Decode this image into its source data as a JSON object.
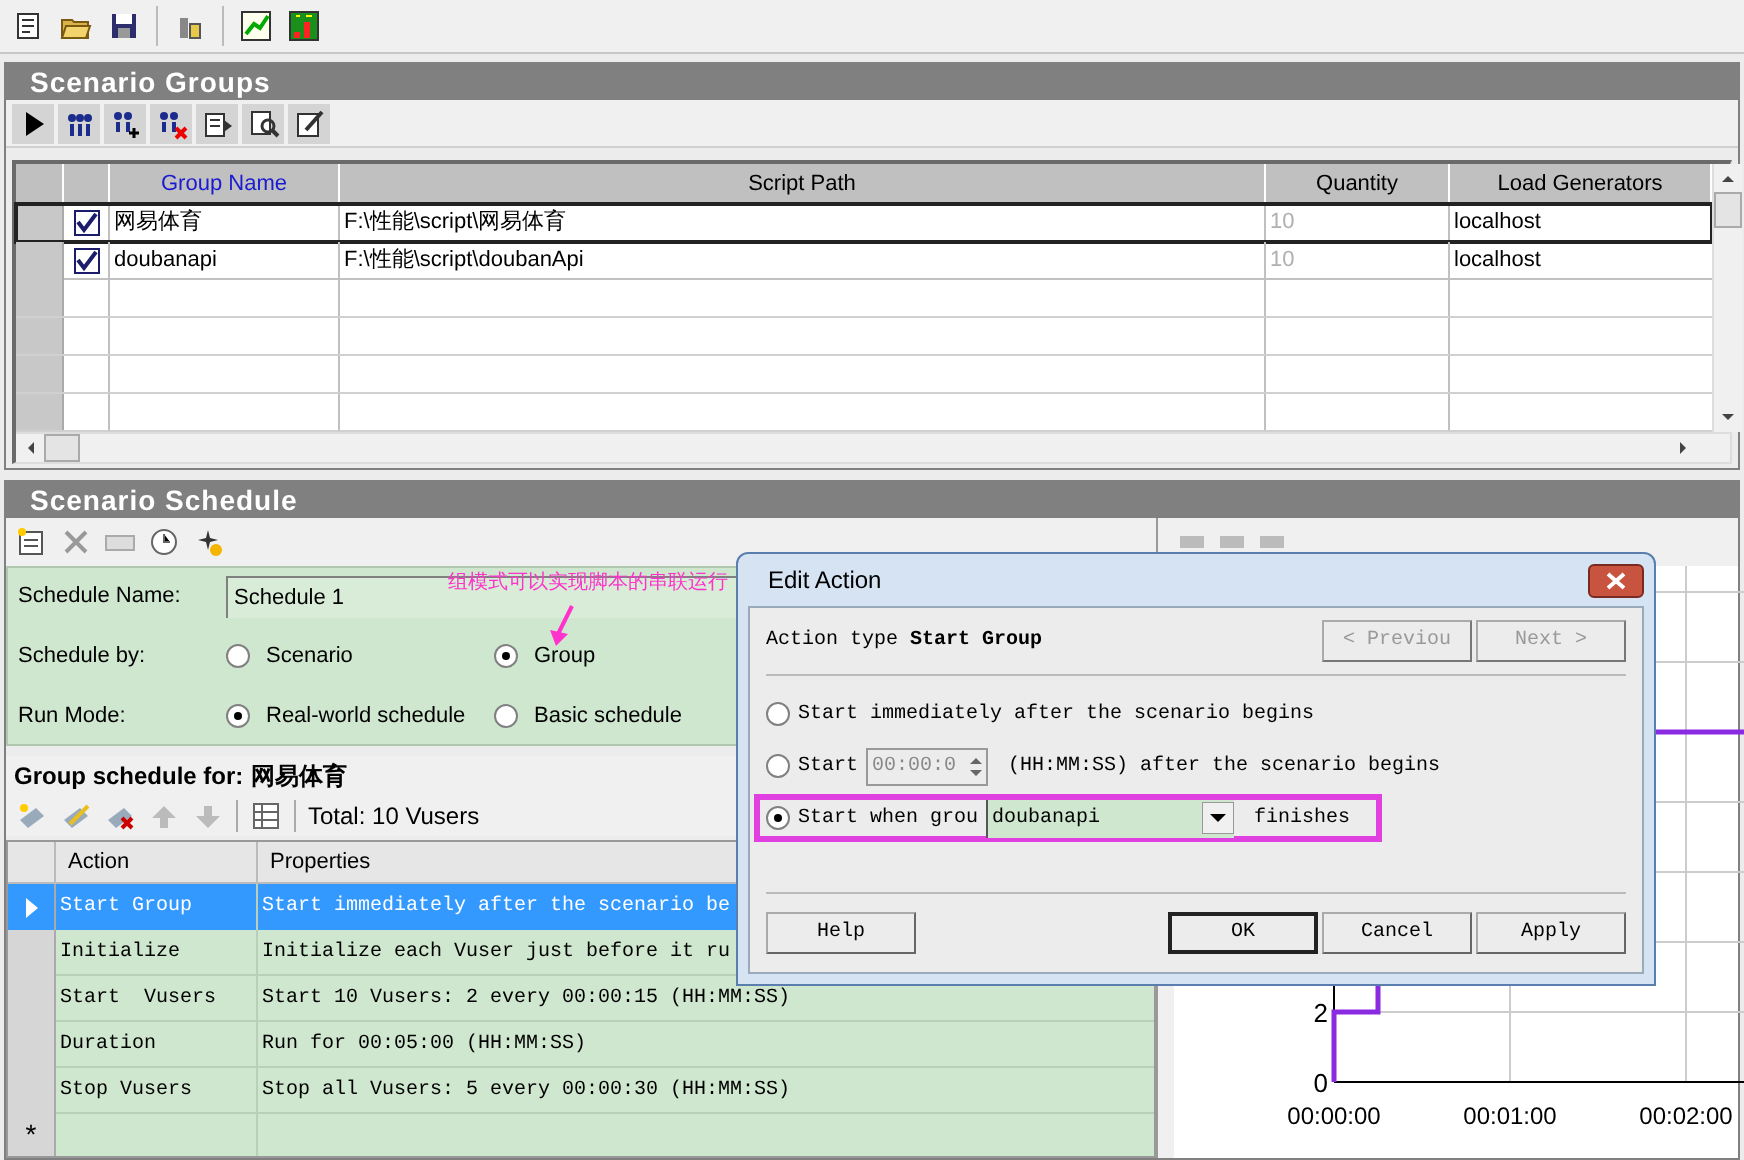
{
  "groups_panel": {
    "title": "Scenario Groups",
    "columns": [
      {
        "label": "Group Name",
        "sorted": true
      },
      {
        "label": "Script Path",
        "sorted": false
      },
      {
        "label": "Quantity",
        "sorted": false
      },
      {
        "label": "Load Generators",
        "sorted": false
      }
    ],
    "rows": [
      {
        "checked": true,
        "selected": true,
        "name": "网易体育",
        "script_path": "F:\\性能\\script\\网易体育",
        "quantity": "10",
        "load_generators": "localhost"
      },
      {
        "checked": true,
        "selected": false,
        "name": "doubanapi",
        "script_path": "F:\\性能\\script\\doubanApi",
        "quantity": "10",
        "load_generators": "localhost"
      }
    ]
  },
  "schedule_panel": {
    "title": "Scenario Schedule",
    "schedule_name_label": "Schedule Name:",
    "schedule_name": "Schedule 1",
    "schedule_by_label": "Schedule by:",
    "schedule_by": [
      {
        "label": "Scenario",
        "selected": false
      },
      {
        "label": "Group",
        "selected": true
      }
    ],
    "run_mode_label": "Run Mode:",
    "run_mode": [
      {
        "label": "Real-world schedule",
        "selected": true
      },
      {
        "label": "Basic schedule",
        "selected": false
      }
    ],
    "group_schedule_label": "Group schedule for:",
    "group_schedule_name": "网易体育",
    "total": "Total: 10 Vusers",
    "columns": [
      "Action",
      "Properties"
    ],
    "actions": [
      {
        "action": "Start Group",
        "properties": "Start immediately after the scenario be",
        "selected": true
      },
      {
        "action": "Initialize",
        "properties": "Initialize each Vuser just before it ru",
        "selected": false
      },
      {
        "action": "Start  Vusers",
        "properties": "Start 10 Vusers: 2 every 00:00:15 (HH:MM:SS)",
        "selected": false
      },
      {
        "action": "Duration",
        "properties": "Run for 00:05:00 (HH:MM:SS)",
        "selected": false
      },
      {
        "action": "Stop Vusers",
        "properties": "Stop all Vusers: 5 every 00:00:30 (HH:MM:SS)",
        "selected": false
      }
    ],
    "new_row_marker": "*",
    "chart": {
      "y_labels": [
        "2",
        "0"
      ],
      "x_labels": [
        "00:00:00",
        "00:01:00",
        "00:02:00"
      ]
    }
  },
  "annotation": "组模式可以实现脚本的串联运行",
  "dialog": {
    "title": "Edit Action",
    "action_type": "Action type **Start Group**",
    "nav_buttons": [
      {
        "label": "< Previou",
        "disabled": true
      },
      {
        "label": "Next >",
        "disabled": true
      }
    ],
    "options": [
      {
        "kind": "plain",
        "label": "Start immediately after the scenario begins",
        "selected": false
      },
      {
        "kind": "delay",
        "label": "Start",
        "value": "00:00:0",
        "suffix": "(HH:MM:SS) after the scenario begins",
        "selected": false
      },
      {
        "kind": "group",
        "label": "Start when grou",
        "value": "doubanapi",
        "suffix": "finishes",
        "selected": true,
        "highlighted": true
      }
    ],
    "buttons": [
      {
        "label": "Help",
        "default": false
      },
      {
        "label": "OK",
        "default": true
      },
      {
        "label": "Cancel",
        "default": false
      },
      {
        "label": "Apply",
        "default": false
      }
    ]
  }
}
